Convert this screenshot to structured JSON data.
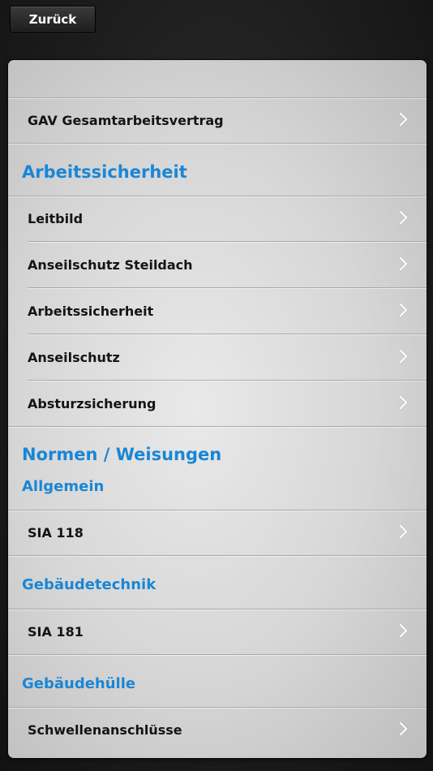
{
  "nav": {
    "back_label": "Zurück"
  },
  "sections": {
    "top": {
      "items": [
        "GAV Gesamtarbeitsvertrag"
      ]
    },
    "arbeitssicherheit": {
      "title": "Arbeitssicherheit",
      "items": [
        "Leitbild",
        "Anseilschutz Steildach",
        "Arbeitssicherheit",
        "Anseilschutz",
        "Absturzsicherung"
      ]
    },
    "normen": {
      "title": "Normen / Weisungen",
      "allgemein": {
        "title": "Allgemein",
        "items": [
          "SIA 118"
        ]
      },
      "gebaeudetechnik": {
        "title": "Gebäudetechnik",
        "items": [
          "SIA 181"
        ]
      },
      "gebaeudehuelle": {
        "title": "Gebäudehülle",
        "items": [
          "Schwellenanschlüsse"
        ]
      }
    }
  },
  "colors": {
    "section_header": "#1a86d6",
    "background": "#1c1c1c",
    "panel": "#dcdcdc"
  },
  "icons": {
    "row_disclosure": "chevron-right-icon"
  }
}
